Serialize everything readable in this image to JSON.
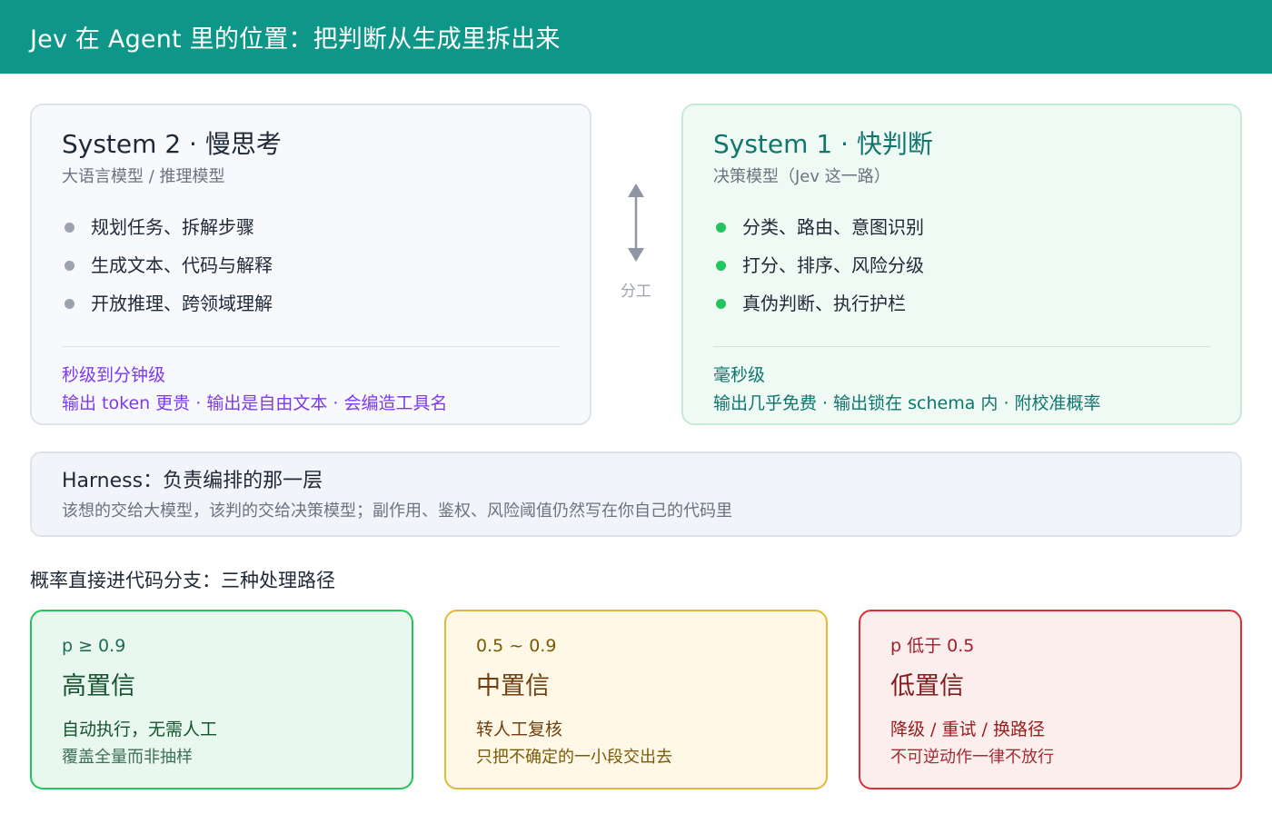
{
  "header": {
    "title": "Jev 在 Agent 里的位置：把判断从生成里拆出来"
  },
  "system2": {
    "title": "System 2 · 慢思考",
    "subtitle": "大语言模型 / 推理模型",
    "bullets": [
      "规划任务、拆解步骤",
      "生成文本、代码与解释",
      "开放推理、跨领域理解"
    ],
    "latency": "秒级到分钟级",
    "traits": "输出 token 更贵 · 输出是自由文本 · 会编造工具名"
  },
  "divider": {
    "label": "分工"
  },
  "system1": {
    "title": "System 1 · 快判断",
    "subtitle": "决策模型（Jev 这一路）",
    "bullets": [
      "分类、路由、意图识别",
      "打分、排序、风险分级",
      "真伪判断、执行护栏"
    ],
    "latency": "毫秒级",
    "traits": "输出几乎免费 · 输出锁在 schema 内 · 附校准概率"
  },
  "harness": {
    "title": "Harness：负责编排的那一层",
    "desc": "该想的交给大模型，该判的交给决策模型；副作用、鉴权、风险阈值仍然写在你自己的代码里"
  },
  "paths": {
    "title": "概率直接进代码分支：三种处理路径",
    "high": {
      "range": "p ≥ 0.9",
      "name": "高置信",
      "action": "自动执行，无需人工",
      "note": "覆盖全量而非抽样"
    },
    "mid": {
      "range": "0.5 ~ 0.9",
      "name": "中置信",
      "action": "转人工复核",
      "note": "只把不确定的一小段交出去"
    },
    "low": {
      "range": "p 低于 0.5",
      "name": "低置信",
      "action": "降级 / 重试 / 换路径",
      "note": "不可逆动作一律不放行"
    }
  },
  "colors": {
    "header": "#0e9688",
    "system1_accent": "#0f766e",
    "system2_accent": "#7c3aed",
    "high_border": "#22c55e",
    "mid_border": "#e2b93b",
    "low_border": "#dc2f3a"
  }
}
